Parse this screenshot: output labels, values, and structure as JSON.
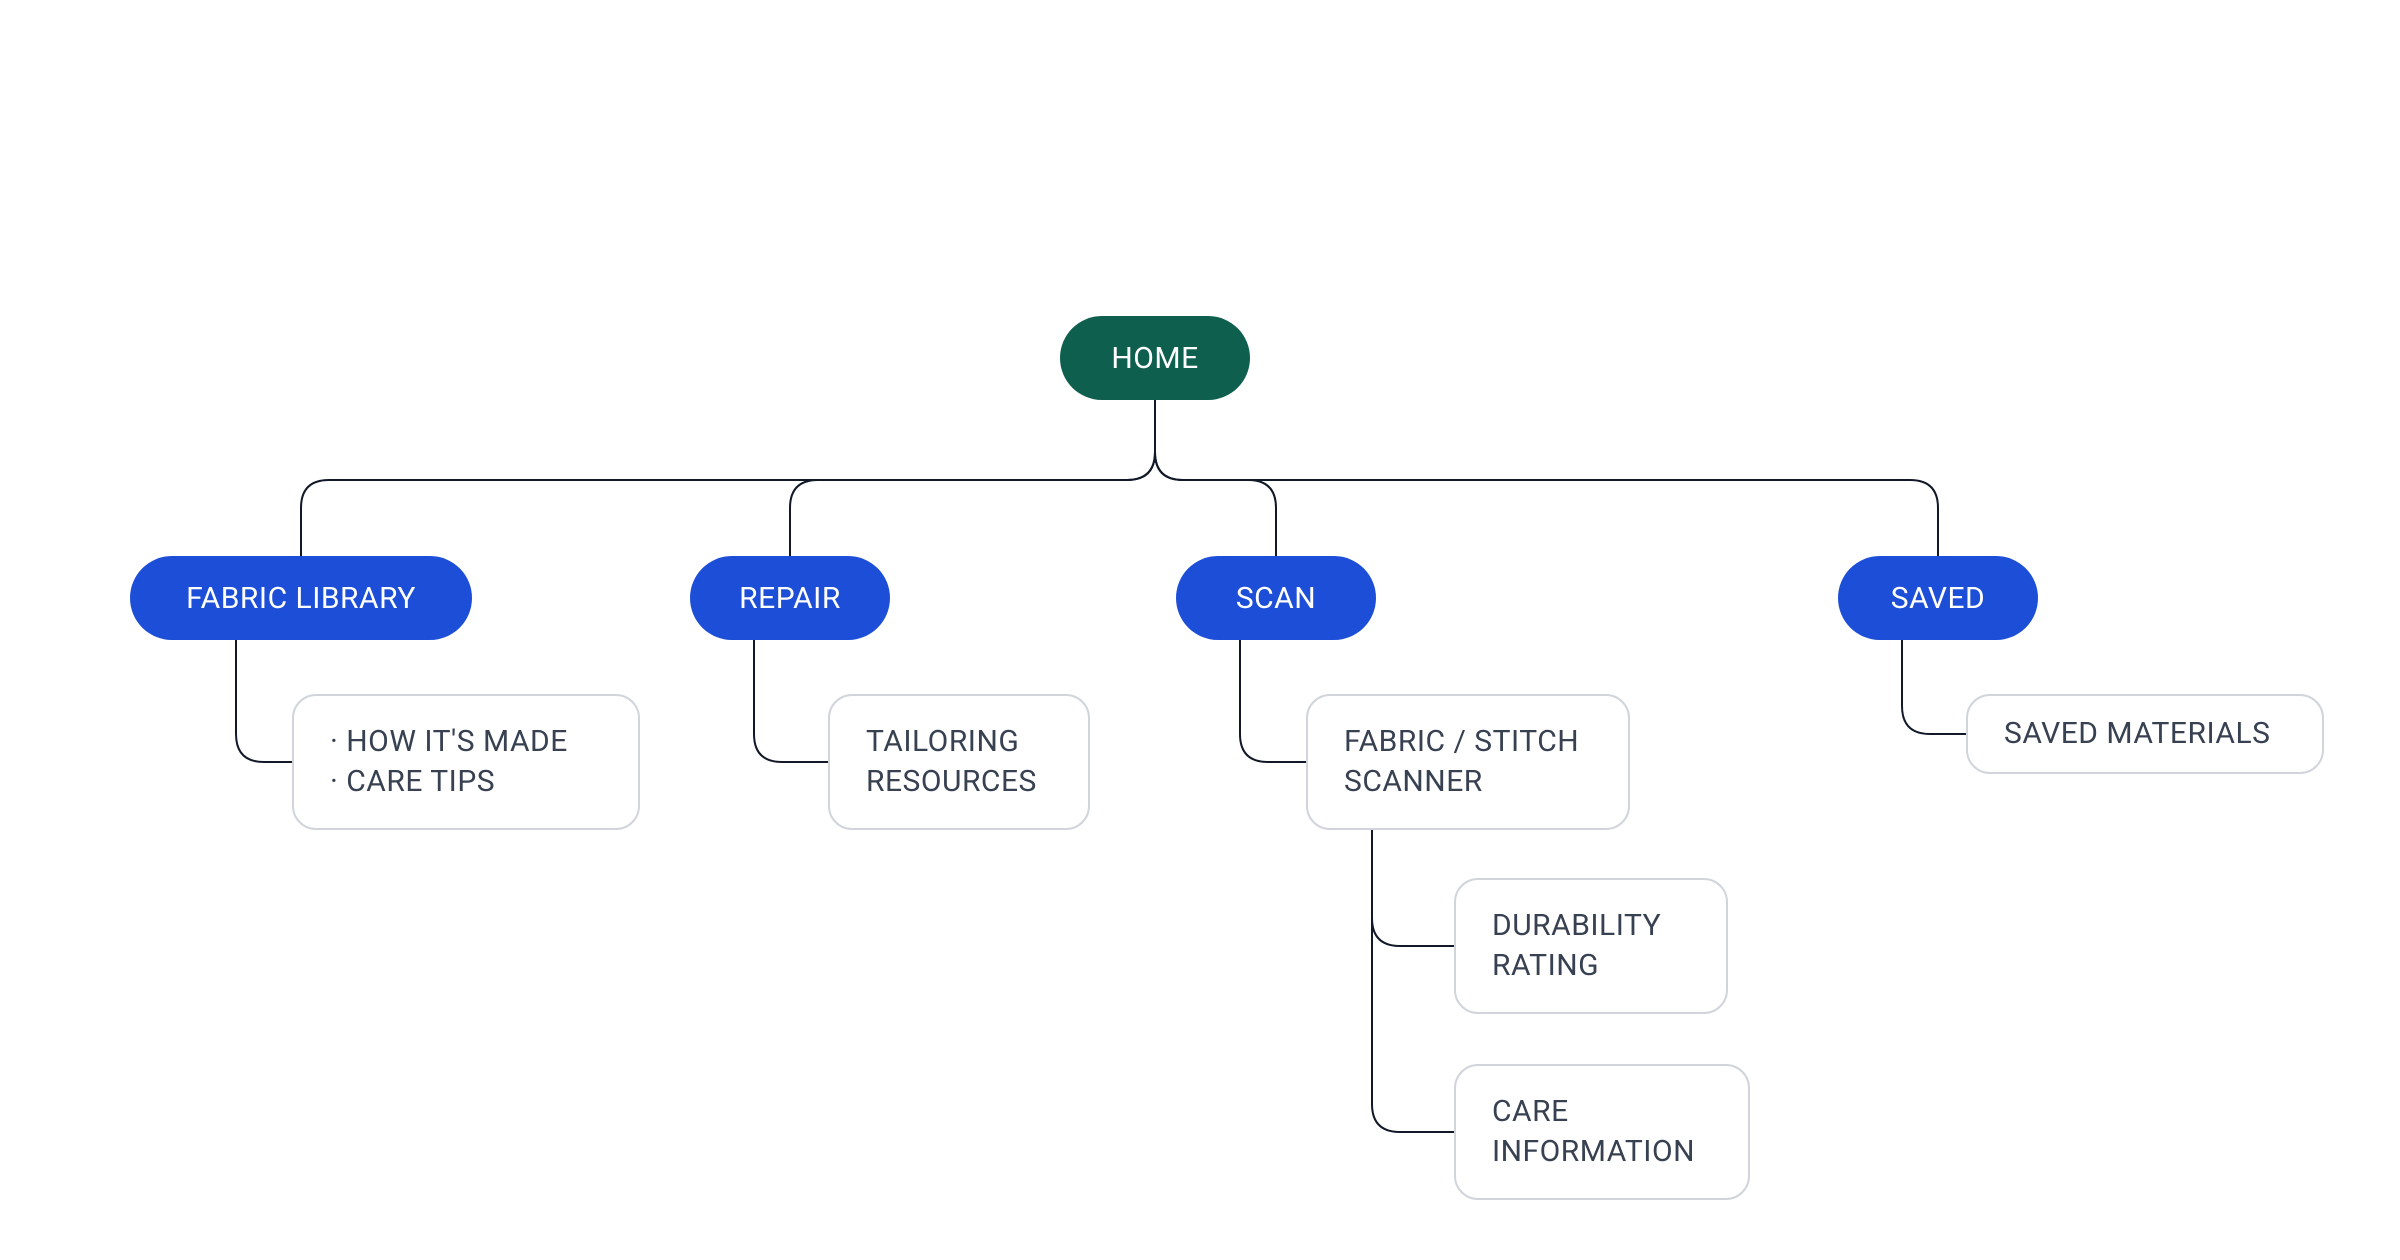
{
  "root": {
    "label": "HOME"
  },
  "sections": {
    "fabric_library": {
      "label": "FABRIC LIBRARY"
    },
    "repair": {
      "label": "REPAIR"
    },
    "scan": {
      "label": "SCAN"
    },
    "saved": {
      "label": "SAVED"
    }
  },
  "leaves": {
    "fabric_library_details": "· HOW IT'S MADE\n· CARE TIPS",
    "repair_details": "TAILORING\nRESOURCES",
    "scan_details": "FABRIC / STITCH\nSCANNER",
    "scan_durability": "DURABILITY\nRATING",
    "scan_care": "CARE\nINFORMATION",
    "saved_details": "SAVED MATERIALS"
  },
  "colors": {
    "root_bg": "#0f5f4e",
    "section_bg": "#1d4ed8",
    "leaf_border": "#d1d5db",
    "connector": "#111827"
  }
}
